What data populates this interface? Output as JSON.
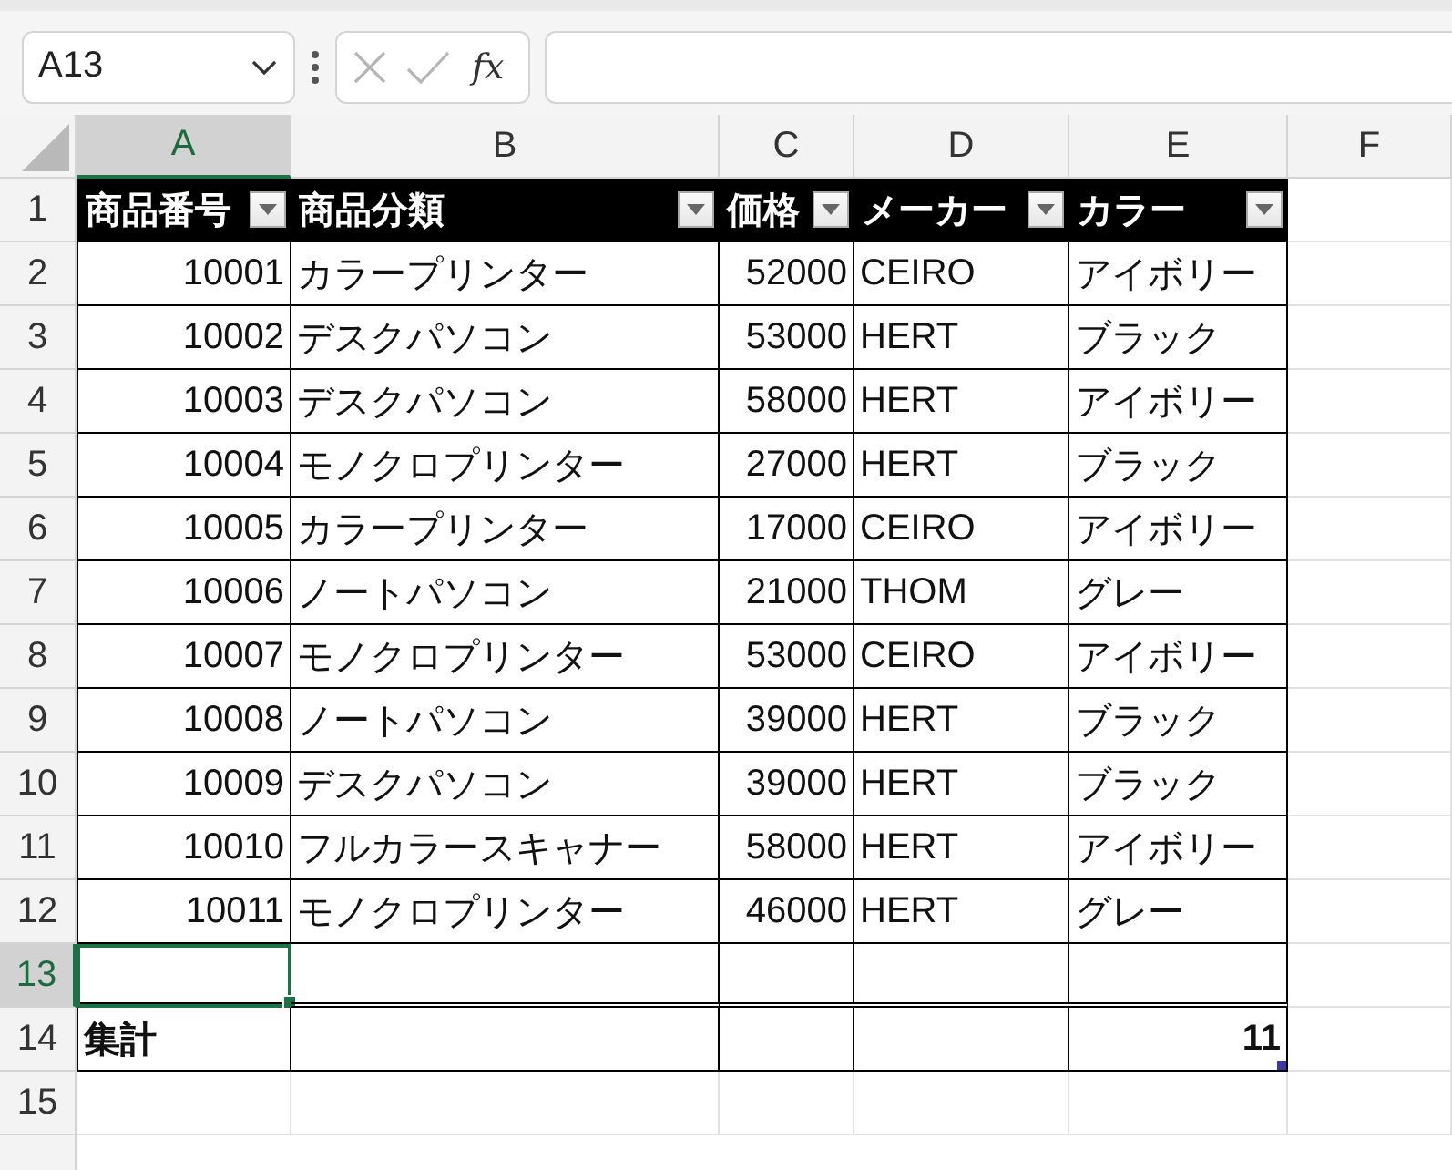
{
  "name_box": {
    "value": "A13"
  },
  "formula_bar": {
    "function_label": "fx"
  },
  "columns": [
    {
      "label": "A",
      "selected": true
    },
    {
      "label": "B",
      "selected": false
    },
    {
      "label": "C",
      "selected": false
    },
    {
      "label": "D",
      "selected": false
    },
    {
      "label": "E",
      "selected": false
    },
    {
      "label": "F",
      "selected": false
    }
  ],
  "row_numbers": [
    {
      "label": "1",
      "selected": false
    },
    {
      "label": "2",
      "selected": false
    },
    {
      "label": "3",
      "selected": false
    },
    {
      "label": "4",
      "selected": false
    },
    {
      "label": "5",
      "selected": false
    },
    {
      "label": "6",
      "selected": false
    },
    {
      "label": "7",
      "selected": false
    },
    {
      "label": "8",
      "selected": false
    },
    {
      "label": "9",
      "selected": false
    },
    {
      "label": "10",
      "selected": false
    },
    {
      "label": "11",
      "selected": false
    },
    {
      "label": "12",
      "selected": false
    },
    {
      "label": "13",
      "selected": true
    },
    {
      "label": "14",
      "selected": false
    },
    {
      "label": "15",
      "selected": false
    }
  ],
  "table": {
    "headers": [
      {
        "label": "商品番号",
        "kind": "number"
      },
      {
        "label": "商品分類",
        "kind": "text"
      },
      {
        "label": "価格",
        "kind": "number"
      },
      {
        "label": "メーカー",
        "kind": "text"
      },
      {
        "label": "カラー",
        "kind": "text"
      }
    ],
    "rows": [
      [
        "10001",
        "カラープリンター",
        "52000",
        "CEIRO",
        "アイボリー"
      ],
      [
        "10002",
        "デスクパソコン",
        "53000",
        "HERT",
        "ブラック"
      ],
      [
        "10003",
        "デスクパソコン",
        "58000",
        "HERT",
        "アイボリー"
      ],
      [
        "10004",
        "モノクロプリンター",
        "27000",
        "HERT",
        "ブラック"
      ],
      [
        "10005",
        "カラープリンター",
        "17000",
        "CEIRO",
        "アイボリー"
      ],
      [
        "10006",
        "ノートパソコン",
        "21000",
        "THOM",
        "グレー"
      ],
      [
        "10007",
        "モノクロプリンター",
        "53000",
        "CEIRO",
        "アイボリー"
      ],
      [
        "10008",
        "ノートパソコン",
        "39000",
        "HERT",
        "ブラック"
      ],
      [
        "10009",
        "デスクパソコン",
        "39000",
        "HERT",
        "ブラック"
      ],
      [
        "10010",
        "フルカラースキャナー",
        "58000",
        "HERT",
        "アイボリー"
      ],
      [
        "10011",
        "モノクロプリンター",
        "46000",
        "HERT",
        "グレー"
      ]
    ],
    "total": {
      "label": "集計",
      "value": "11"
    }
  }
}
